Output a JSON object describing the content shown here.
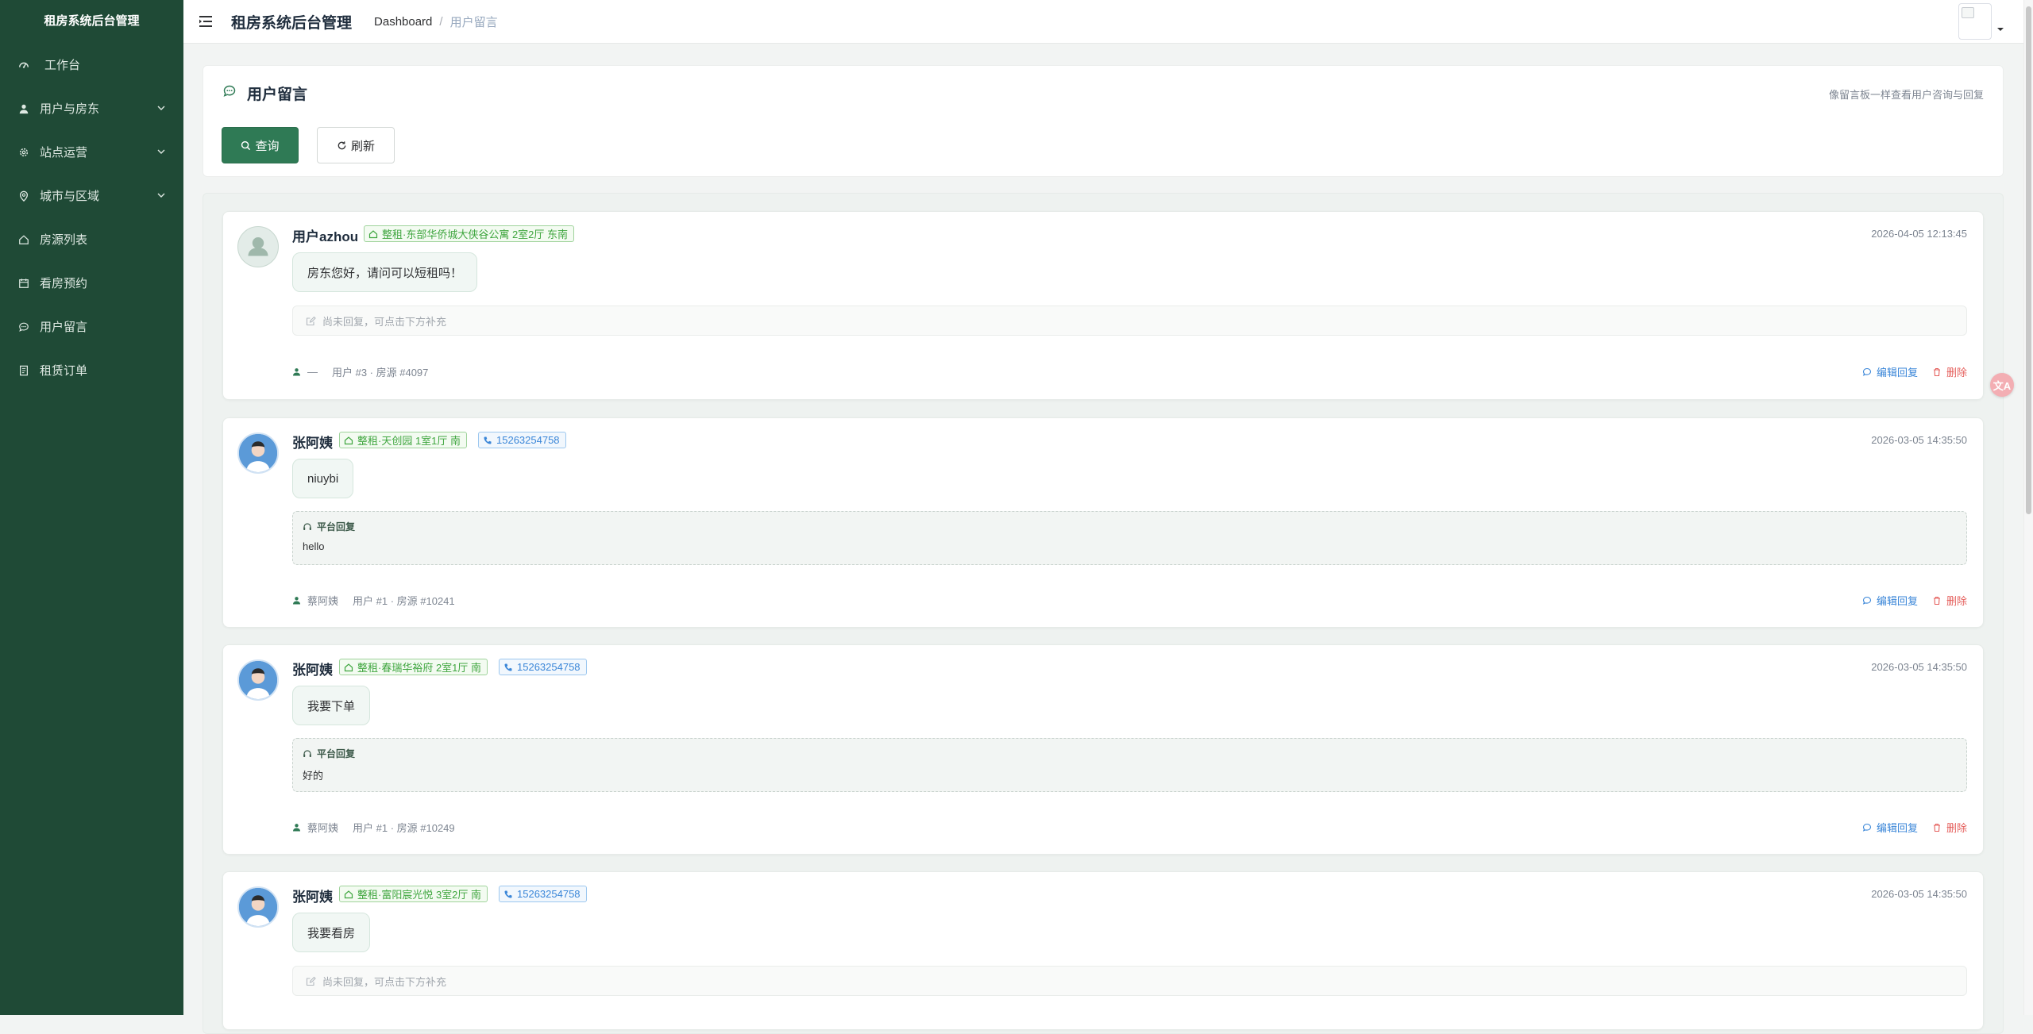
{
  "sidebar": {
    "logo": "租房系统后台管理",
    "items": [
      {
        "label": "工作台",
        "icon": "dashboard-icon",
        "has_children": false
      },
      {
        "label": "用户与房东",
        "icon": "user-icon",
        "has_children": true
      },
      {
        "label": "站点运营",
        "icon": "gear-icon",
        "has_children": true
      },
      {
        "label": "城市与区域",
        "icon": "location-icon",
        "has_children": true
      },
      {
        "label": "房源列表",
        "icon": "house-icon",
        "has_children": false
      },
      {
        "label": "看房预约",
        "icon": "calendar-icon",
        "has_children": false
      },
      {
        "label": "用户留言",
        "icon": "chat-icon",
        "has_children": false
      },
      {
        "label": "租赁订单",
        "icon": "document-icon",
        "has_children": false
      }
    ]
  },
  "header": {
    "title": "租房系统后台管理",
    "breadcrumb": [
      "Dashboard",
      "用户留言"
    ],
    "separator": "/"
  },
  "page": {
    "title": "用户留言",
    "subtitle": "像留言板一样查看用户咨询与回复",
    "query_label": "查询",
    "refresh_label": "刷新"
  },
  "messages": [
    {
      "name": "用户azhou",
      "avatar": "default",
      "house_tag": "整租·东部华侨城大侠谷公寓 2室2厅 东南",
      "phone": "",
      "time": "2026-04-05 12:13:45",
      "content": "房东您好，请问可以短租吗！",
      "reply_header": "",
      "reply_text": "",
      "no_reply": "尚未回复，可点击下方补充",
      "landlord": "—",
      "meta": "用户 #3 · 房源 #4097"
    },
    {
      "name": "张阿姨",
      "avatar": "photo",
      "house_tag": "整租·天创园 1室1厅 南",
      "phone": "15263254758",
      "time": "2026-03-05 14:35:50",
      "content": "niuybi",
      "reply_header": "平台回复",
      "reply_text": "hello",
      "no_reply": "",
      "landlord": "蔡阿姨",
      "meta": "用户 #1 · 房源 #10241"
    },
    {
      "name": "张阿姨",
      "avatar": "photo",
      "house_tag": "整租·春瑞华裕府 2室1厅 南",
      "phone": "15263254758",
      "time": "2026-03-05 14:35:50",
      "content": "我要下单",
      "reply_header": "平台回复",
      "reply_text": "好的",
      "no_reply": "",
      "landlord": "蔡阿姨",
      "meta": "用户 #1 · 房源 #10249"
    },
    {
      "name": "张阿姨",
      "avatar": "photo",
      "house_tag": "整租·富阳宸光悦 3室2厅 南",
      "phone": "15263254758",
      "time": "2026-03-05 14:35:50",
      "content": "我要看房",
      "reply_header": "",
      "reply_text": "",
      "no_reply": "尚未回复，可点击下方补充",
      "landlord": "",
      "meta": ""
    }
  ],
  "actions": {
    "edit_label": "编辑回复",
    "delete_label": "删除"
  },
  "float_button": "文A",
  "colors": {
    "sidebar_bg": "#1f4a36",
    "primary": "#2f7a55",
    "tag_green": "#3fa63f",
    "tag_blue": "#3a86d8",
    "danger": "#e5605d"
  }
}
